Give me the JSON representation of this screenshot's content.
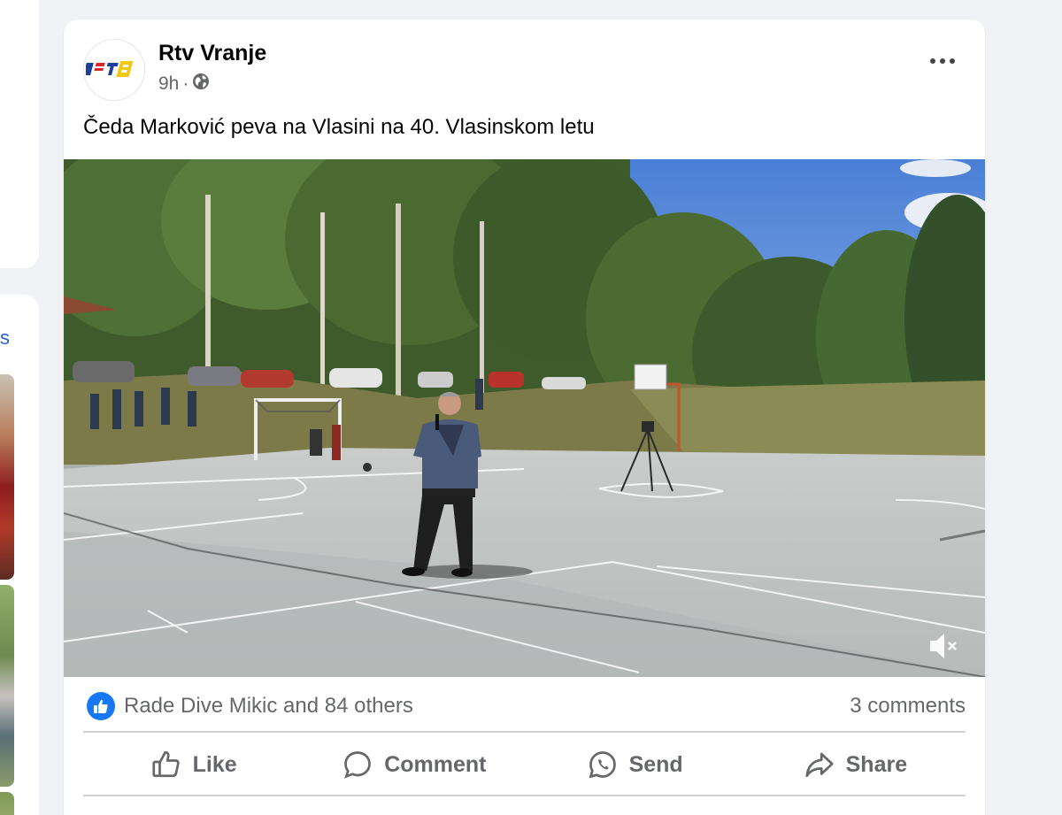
{
  "sidebar": {
    "link_fragment": "s"
  },
  "post": {
    "author": "Rtv Vranje",
    "time": "9h",
    "separator": "·",
    "caption": "Čeda Marković peva na Vlasini na 40. Vlasinskom letu",
    "logo_text": "RTV",
    "reactions_text": "Rade Dive Mikic and 84 others",
    "comments_text": "3 comments",
    "video": {
      "muted": true
    }
  },
  "actions": {
    "like": "Like",
    "comment": "Comment",
    "send": "Send",
    "share": "Share"
  },
  "colors": {
    "accent": "#1877f2",
    "secondary_text": "#65676b"
  }
}
